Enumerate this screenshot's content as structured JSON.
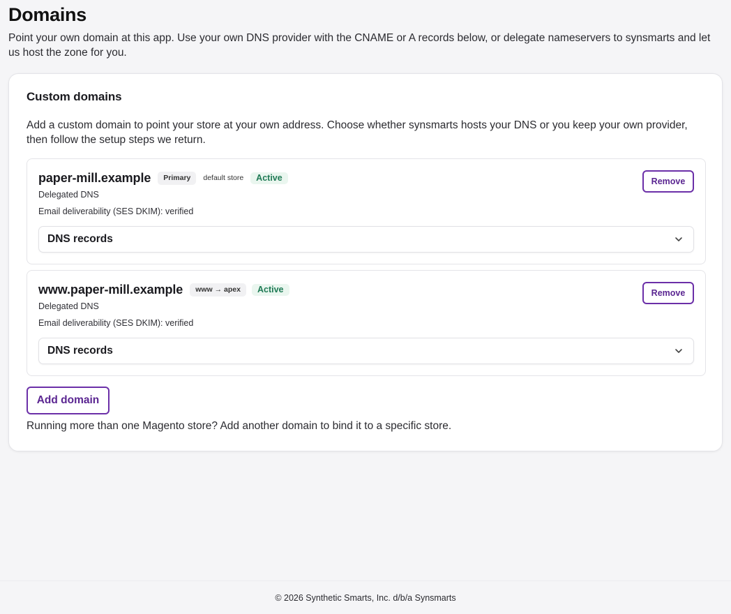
{
  "page": {
    "title": "Domains",
    "subtitle": "Point your own domain at this app. Use your own DNS provider with the CNAME or A records below, or delegate nameservers to synsmarts and let us host the zone for you."
  },
  "custom_domains": {
    "title": "Custom domains",
    "description": "Add a custom domain to point your store at your own address. Choose whether synsmarts hosts your DNS or you keep your own provider, then follow the setup steps we return.",
    "domains": [
      {
        "name": "paper-mill.example",
        "tags": [
          "Primary",
          "default store"
        ],
        "status": "Active",
        "dns_mode": "Delegated DNS",
        "email": "Email deliverability (SES DKIM): verified",
        "remove_label": "Remove",
        "dns_records_label": "DNS records"
      },
      {
        "name": "www.paper-mill.example",
        "tags": [
          "www → apex"
        ],
        "status": "Active",
        "dns_mode": "Delegated DNS",
        "email": "Email deliverability (SES DKIM): verified",
        "remove_label": "Remove",
        "dns_records_label": "DNS records"
      }
    ],
    "add_label": "Add domain",
    "hint": "Running more than one Magento store? Add another domain to bind it to a specific store."
  },
  "footer": {
    "text": "© 2026 Synthetic Smarts, Inc. d/b/a Synsmarts"
  },
  "colors": {
    "accent": "#6b2fa8",
    "active_text": "#1f7a55",
    "active_bg": "#eaf6ef"
  },
  "icons": {
    "accordion": "chevron-down-icon"
  }
}
